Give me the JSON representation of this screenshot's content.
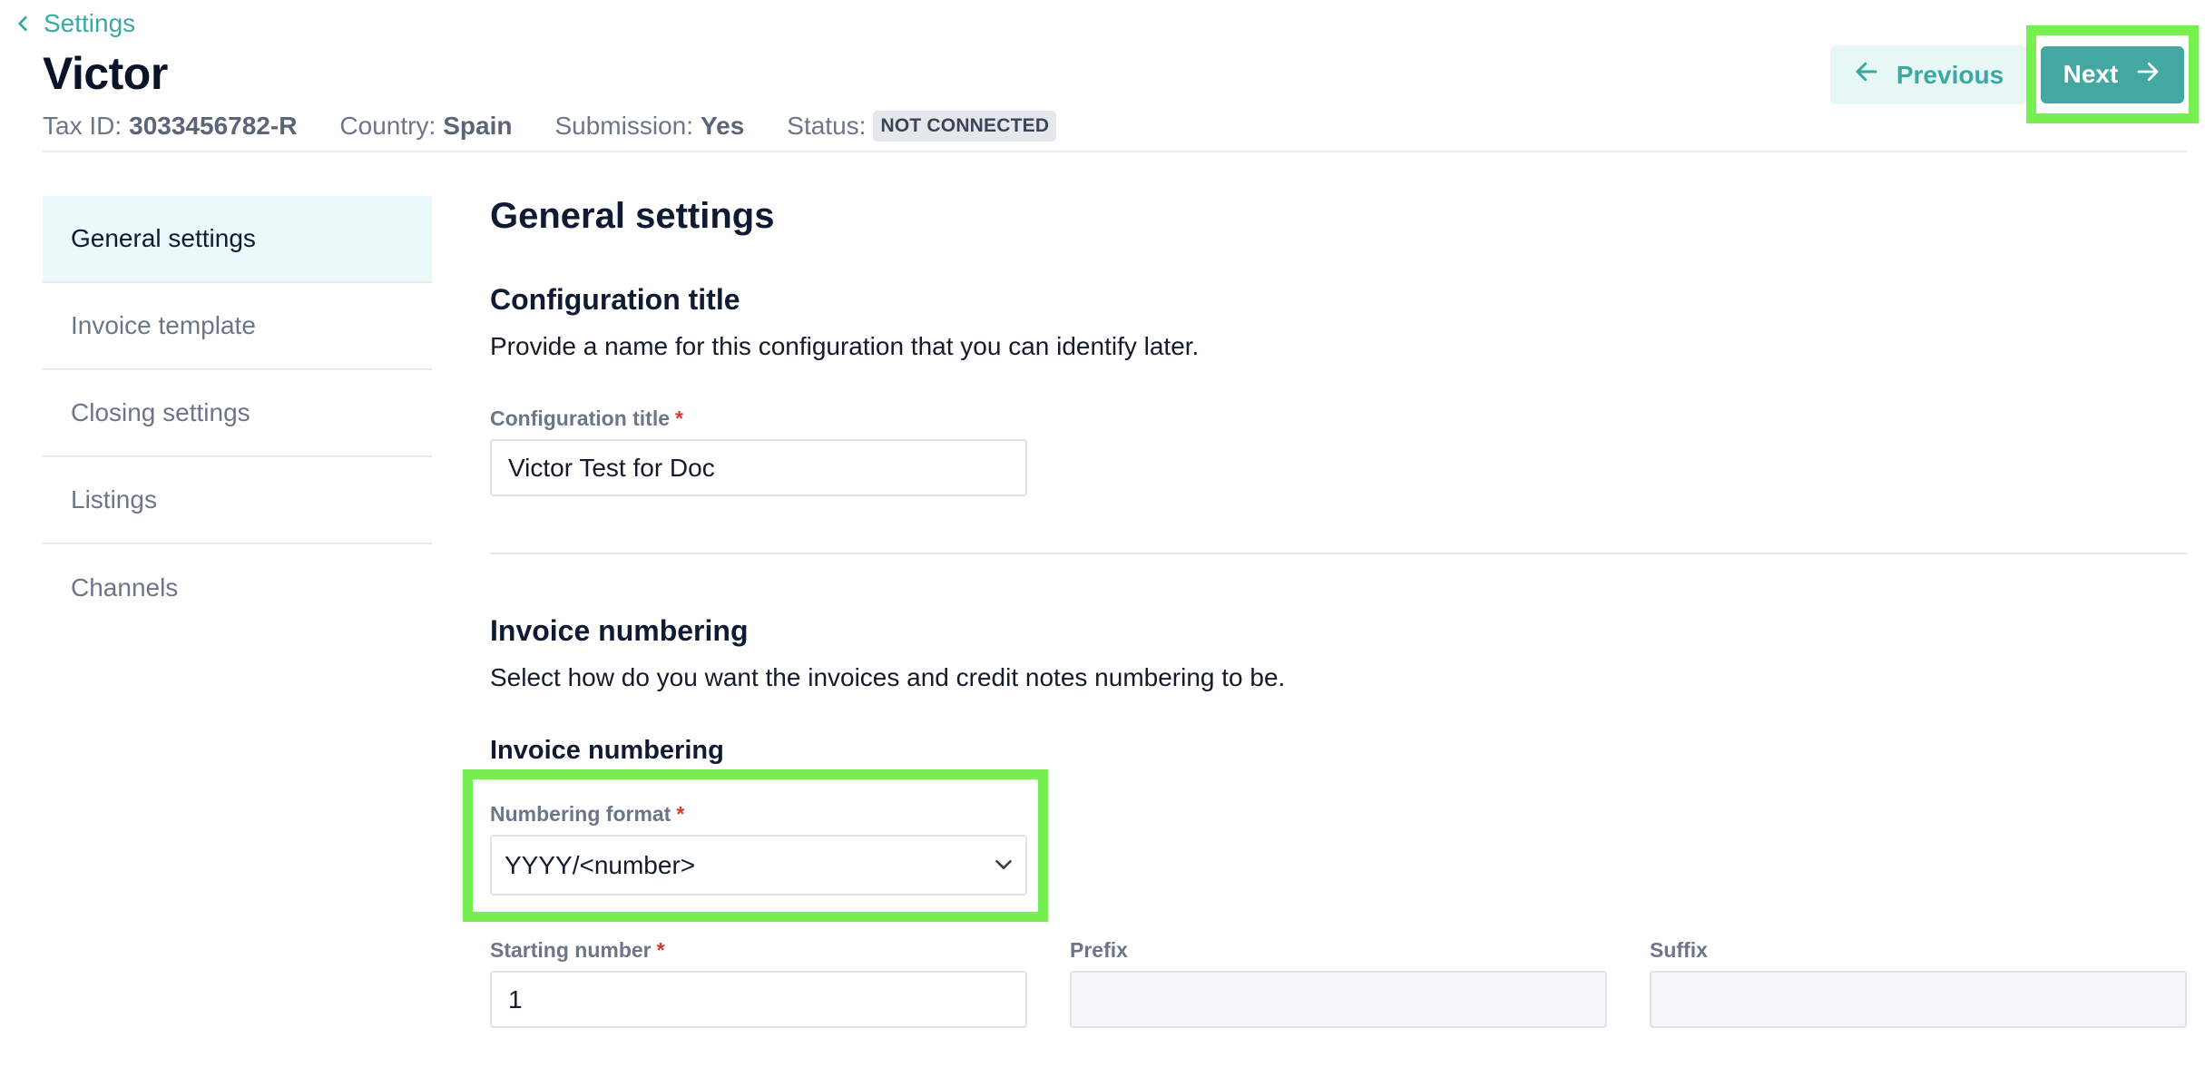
{
  "nav": {
    "back_label": "Settings"
  },
  "header": {
    "title": "Victor",
    "meta": [
      {
        "key": "Tax ID:",
        "value": "3033456782-R"
      },
      {
        "key": "Country:",
        "value": "Spain"
      },
      {
        "key": "Submission:",
        "value": "Yes"
      }
    ],
    "status_label": "Status:",
    "status_badge": "NOT CONNECTED",
    "previous_label": "Previous",
    "next_label": "Next"
  },
  "sidebar": {
    "items": [
      {
        "label": "General settings",
        "active": true
      },
      {
        "label": "Invoice template",
        "active": false
      },
      {
        "label": "Closing settings",
        "active": false
      },
      {
        "label": "Listings",
        "active": false
      },
      {
        "label": "Channels",
        "active": false
      }
    ]
  },
  "main": {
    "heading": "General settings",
    "config": {
      "heading": "Configuration title",
      "description": "Provide a name for this configuration that you can identify later.",
      "field_label": "Configuration title",
      "field_value": "Victor Test for Doc"
    },
    "numbering": {
      "heading": "Invoice numbering",
      "description": "Select how do you want the invoices and credit notes numbering to be.",
      "subheading": "Invoice numbering",
      "format_label": "Numbering format",
      "format_value": "YYYY/<number>",
      "starting_label": "Starting number",
      "starting_value": "1",
      "prefix_label": "Prefix",
      "prefix_value": "",
      "suffix_label": "Suffix",
      "suffix_value": ""
    },
    "required_mark": "*"
  },
  "colors": {
    "accent": "#44a8a2",
    "accent_light": "#e7f7f6",
    "highlight": "#77ee52",
    "required": "#d23b2b"
  },
  "icons": {
    "back": "chevron-left-icon",
    "previous": "arrow-left-icon",
    "next": "arrow-right-icon",
    "select": "chevron-down-icon"
  }
}
